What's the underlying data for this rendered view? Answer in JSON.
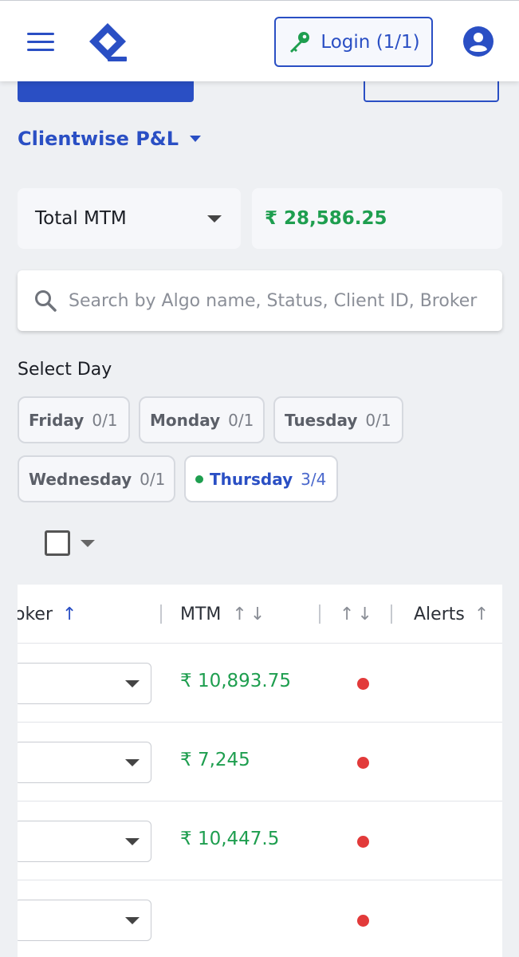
{
  "header": {
    "login_label": "Login (1/1)"
  },
  "section": {
    "title": "Clientwise P&L"
  },
  "summary": {
    "metric_label": "Total MTM",
    "metric_value": "₹ 28,586.25"
  },
  "search": {
    "placeholder": "Search by Algo name, Status, Client ID, Broker"
  },
  "day_filter": {
    "label": "Select Day",
    "days": [
      {
        "day": "Friday",
        "count": "0/1",
        "active": false
      },
      {
        "day": "Monday",
        "count": "0/1",
        "active": false
      },
      {
        "day": "Tuesday",
        "count": "0/1",
        "active": false
      },
      {
        "day": "Wednesday",
        "count": "0/1",
        "active": false
      },
      {
        "day": "Thursday",
        "count": "3/4",
        "active": true
      }
    ]
  },
  "table": {
    "columns": {
      "broker": "oker",
      "mtm": "MTM",
      "alerts": "Alerts"
    },
    "arrows": {
      "up": "↑",
      "down": "↓"
    },
    "rows": [
      {
        "mtm": "₹ 10,893.75",
        "status": "red"
      },
      {
        "mtm": "₹ 7,245",
        "status": "red"
      },
      {
        "mtm": "₹ 10,447.5",
        "status": "red"
      },
      {
        "mtm": "",
        "status": "red"
      }
    ]
  },
  "colors": {
    "accent": "#2a4fc4",
    "positive": "#1e9e4f",
    "alert": "#e23a3a"
  }
}
